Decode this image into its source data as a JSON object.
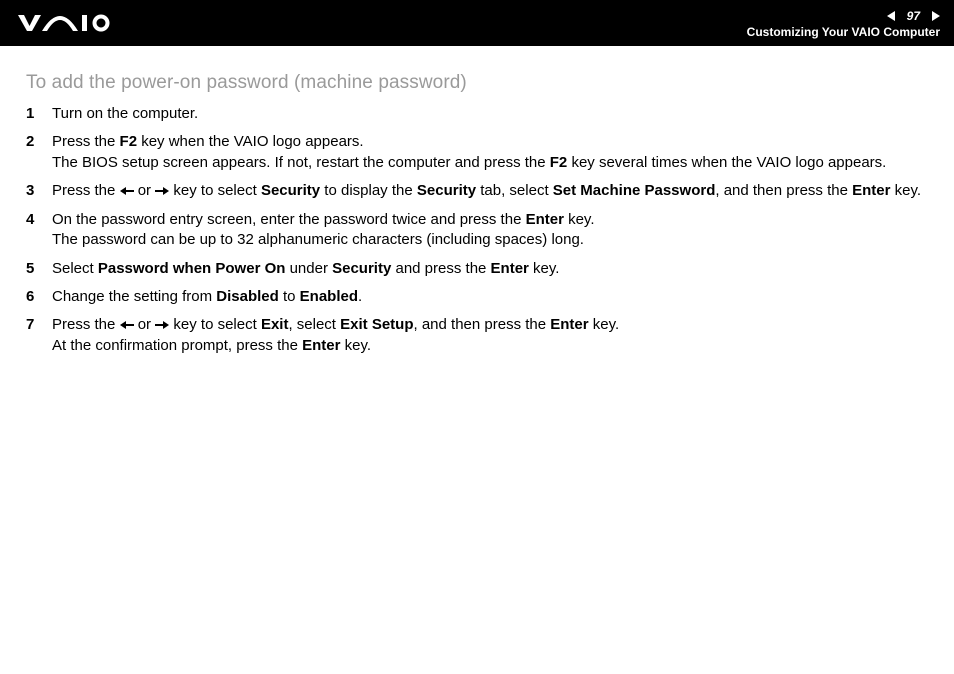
{
  "header": {
    "page_number": "97",
    "section": "Customizing Your VAIO Computer"
  },
  "title": "To add the power-on password (machine password)",
  "steps": {
    "s1": {
      "num": "1",
      "text": "Turn on the computer."
    },
    "s2": {
      "num": "2",
      "l1a": "Press the ",
      "l1b": "F2",
      "l1c": " key when the VAIO logo appears.",
      "l2a": "The BIOS setup screen appears. If not, restart the computer and press the ",
      "l2b": "F2",
      "l2c": " key several times when the VAIO logo appears."
    },
    "s3": {
      "num": "3",
      "a": "Press the ",
      "b": " or ",
      "c": " key to select ",
      "d": "Security",
      "e": " to display the ",
      "f": "Security",
      "g": " tab, select ",
      "h": "Set Machine Password",
      "i": ", and then press the ",
      "j": "Enter",
      "k": " key."
    },
    "s4": {
      "num": "4",
      "l1a": "On the password entry screen, enter the password twice and press the ",
      "l1b": "Enter",
      "l1c": " key.",
      "l2": "The password can be up to 32 alphanumeric characters (including spaces) long."
    },
    "s5": {
      "num": "5",
      "a": "Select ",
      "b": "Password when Power On",
      "c": " under ",
      "d": "Security",
      "e": " and press the ",
      "f": "Enter",
      "g": " key."
    },
    "s6": {
      "num": "6",
      "a": "Change the setting from ",
      "b": "Disabled",
      "c": " to ",
      "d": "Enabled",
      "e": "."
    },
    "s7": {
      "num": "7",
      "l1a": "Press the ",
      "l1b": " or ",
      "l1c": " key to select ",
      "l1d": "Exit",
      "l1e": ", select ",
      "l1f": "Exit Setup",
      "l1g": ", and then press the ",
      "l1h": "Enter",
      "l1i": " key.",
      "l2a": "At the confirmation prompt, press the ",
      "l2b": "Enter",
      "l2c": " key."
    }
  }
}
